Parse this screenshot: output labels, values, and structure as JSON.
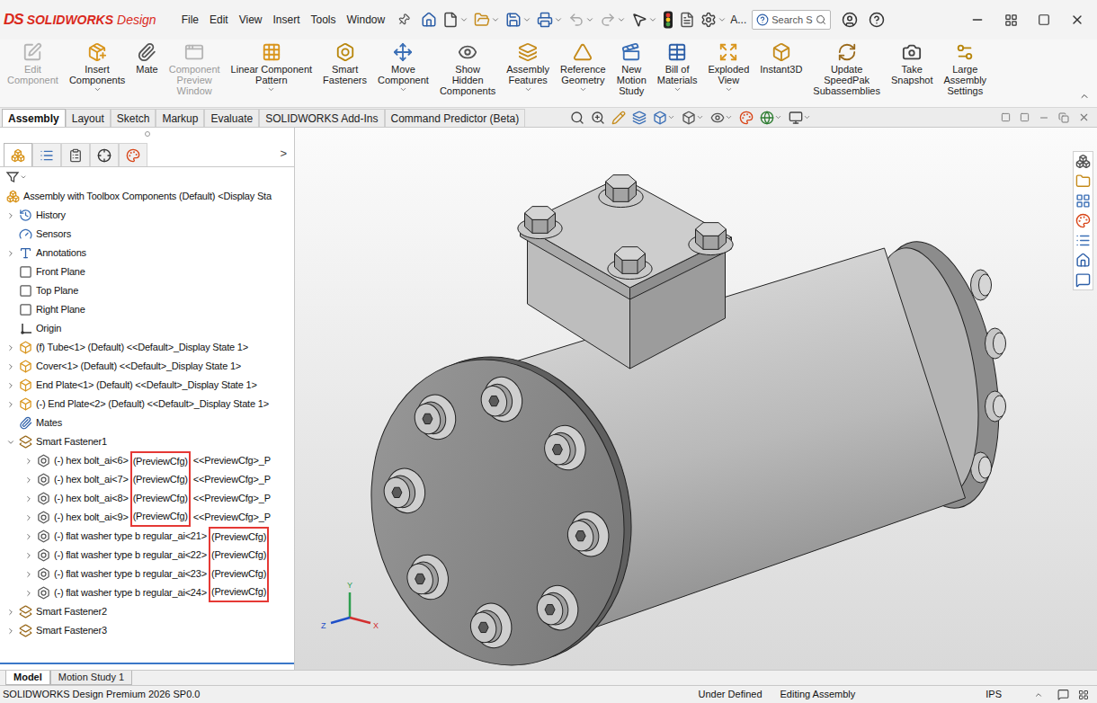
{
  "window": {
    "logo_mark": "DS",
    "brand": "SOLIDWORKS",
    "edition": "Design",
    "user": "A...",
    "search_placeholder": "Search S"
  },
  "menus": [
    "File",
    "Edit",
    "View",
    "Insert",
    "Tools",
    "Window"
  ],
  "quick_access": [
    {
      "dropdown": false,
      "disabled": false
    },
    {
      "dropdown": true,
      "disabled": false
    },
    {
      "dropdown": true,
      "disabled": false
    },
    {
      "dropdown": true,
      "disabled": false
    },
    {
      "dropdown": true,
      "disabled": false
    },
    {
      "dropdown": true,
      "disabled": true
    },
    {
      "dropdown": true,
      "disabled": true
    },
    {
      "dropdown": true,
      "disabled": false
    },
    {
      "dropdown": false,
      "disabled": false
    },
    {
      "dropdown": false,
      "disabled": false
    },
    {
      "dropdown": true,
      "disabled": false
    }
  ],
  "command_manager": [
    {
      "lines": [
        "Edit",
        "Component"
      ],
      "dropdown": false,
      "disabled": true
    },
    {
      "lines": [
        "Insert",
        "Components"
      ],
      "dropdown": true,
      "disabled": false
    },
    {
      "lines": [
        "Mate"
      ],
      "dropdown": false,
      "disabled": false
    },
    {
      "lines": [
        "Component",
        "Preview",
        "Window"
      ],
      "dropdown": false,
      "disabled": true
    },
    {
      "lines": [
        "Linear Component",
        "Pattern"
      ],
      "dropdown": true,
      "disabled": false
    },
    {
      "lines": [
        "Smart",
        "Fasteners"
      ],
      "dropdown": false,
      "disabled": false
    },
    {
      "lines": [
        "Move",
        "Component"
      ],
      "dropdown": true,
      "disabled": false
    },
    {
      "lines": [
        "Show",
        "Hidden",
        "Components"
      ],
      "dropdown": false,
      "disabled": false
    },
    {
      "lines": [
        "Assembly",
        "Features"
      ],
      "dropdown": true,
      "disabled": false
    },
    {
      "lines": [
        "Reference",
        "Geometry"
      ],
      "dropdown": true,
      "disabled": false
    },
    {
      "lines": [
        "New",
        "Motion",
        "Study"
      ],
      "dropdown": false,
      "disabled": false
    },
    {
      "lines": [
        "Bill of",
        "Materials"
      ],
      "dropdown": true,
      "disabled": false
    },
    {
      "lines": [
        "Exploded",
        "View"
      ],
      "dropdown": true,
      "disabled": false
    },
    {
      "lines": [
        "Instant3D"
      ],
      "dropdown": false,
      "disabled": false
    },
    {
      "lines": [
        "Update",
        "SpeedPak",
        "Subassemblies"
      ],
      "dropdown": false,
      "disabled": false
    },
    {
      "lines": [
        "Take",
        "Snapshot"
      ],
      "dropdown": false,
      "disabled": false
    },
    {
      "lines": [
        "Large",
        "Assembly",
        "Settings"
      ],
      "dropdown": false,
      "disabled": false
    }
  ],
  "ribbon_tabs": [
    {
      "label": "Assembly",
      "selected": true
    },
    {
      "label": "Layout",
      "selected": false
    },
    {
      "label": "Sketch",
      "selected": false
    },
    {
      "label": "Markup",
      "selected": false
    },
    {
      "label": "Evaluate",
      "selected": false
    },
    {
      "label": "SOLIDWORKS Add-Ins",
      "selected": false
    },
    {
      "label": "Command Predictor (Beta)",
      "selected": false
    }
  ],
  "heads_up_toolbar": [
    {
      "dropdown": false
    },
    {
      "dropdown": false
    },
    {
      "dropdown": false
    },
    {
      "dropdown": false
    },
    {
      "dropdown": true
    },
    {
      "dropdown": true
    },
    {
      "dropdown": true
    },
    {
      "dropdown": false
    },
    {
      "dropdown": true
    },
    {
      "dropdown": true
    }
  ],
  "panel_tabs": [
    {
      "selected": true
    },
    {
      "selected": false
    },
    {
      "selected": false
    },
    {
      "selected": false
    },
    {
      "selected": false
    }
  ],
  "panel_overflow": ">",
  "tree": [
    {
      "text": "Assembly with Toolbox Components (Default) <Display Sta",
      "kind": "assembly",
      "depth": 0,
      "expandable": false,
      "expanded": true
    },
    {
      "text": "History",
      "kind": "history",
      "depth": 1,
      "expandable": true,
      "expanded": false
    },
    {
      "text": "Sensors",
      "kind": "sensor",
      "depth": 1,
      "expandable": false,
      "expanded": false
    },
    {
      "text": "Annotations",
      "kind": "annotation",
      "depth": 1,
      "expandable": true,
      "expanded": false
    },
    {
      "text": "Front Plane",
      "kind": "plane",
      "depth": 1,
      "expandable": false,
      "expanded": false
    },
    {
      "text": "Top Plane",
      "kind": "plane",
      "depth": 1,
      "expandable": false,
      "expanded": false
    },
    {
      "text": "Right Plane",
      "kind": "plane",
      "depth": 1,
      "expandable": false,
      "expanded": false
    },
    {
      "text": "Origin",
      "kind": "origin",
      "depth": 1,
      "expandable": false,
      "expanded": false
    },
    {
      "text": "(f) Tube<1> (Default) <<Default>_Display State 1>",
      "kind": "part",
      "depth": 1,
      "expandable": true,
      "expanded": false
    },
    {
      "text": "Cover<1> (Default) <<Default>_Display State 1>",
      "kind": "part",
      "depth": 1,
      "expandable": true,
      "expanded": false
    },
    {
      "text": "End Plate<1> (Default) <<Default>_Display State 1>",
      "kind": "part",
      "depth": 1,
      "expandable": true,
      "expanded": false
    },
    {
      "text": "(-) End Plate<2> (Default) <<Default>_Display State 1>",
      "kind": "part",
      "depth": 1,
      "expandable": true,
      "expanded": false
    },
    {
      "text": "Mates",
      "kind": "mates",
      "depth": 1,
      "expandable": false,
      "expanded": false
    },
    {
      "text": "Smart Fastener1",
      "kind": "smart-fastener",
      "depth": 1,
      "expandable": true,
      "expanded": true
    },
    {
      "text": "(-) hex bolt_ai<6>",
      "config": "(PreviewCfg)",
      "suffix": "<<PreviewCfg>_P",
      "highlighted": true,
      "kind": "fastener",
      "depth": 2,
      "expandable": true,
      "expanded": false
    },
    {
      "text": "(-) hex bolt_ai<7>",
      "config": "(PreviewCfg)",
      "suffix": "<<PreviewCfg>_P",
      "highlighted": true,
      "kind": "fastener",
      "depth": 2,
      "expandable": true,
      "expanded": false
    },
    {
      "text": "(-) hex bolt_ai<8>",
      "config": "(PreviewCfg)",
      "suffix": "<<PreviewCfg>_P",
      "highlighted": true,
      "kind": "fastener",
      "depth": 2,
      "expandable": true,
      "expanded": false
    },
    {
      "text": "(-) hex bolt_ai<9>",
      "config": "(PreviewCfg)",
      "suffix": "<<PreviewCfg>_P",
      "highlighted": true,
      "kind": "fastener",
      "depth": 2,
      "expandable": true,
      "expanded": false
    },
    {
      "text": "(-) flat washer type b regular_ai<21>",
      "config": "(PreviewCfg)",
      "highlighted": true,
      "kind": "fastener",
      "depth": 2,
      "expandable": true,
      "expanded": false
    },
    {
      "text": "(-) flat washer type b regular_ai<22>",
      "config": "(PreviewCfg)",
      "highlighted": true,
      "kind": "fastener",
      "depth": 2,
      "expandable": true,
      "expanded": false
    },
    {
      "text": "(-) flat washer type b regular_ai<23>",
      "config": "(PreviewCfg)",
      "highlighted": true,
      "kind": "fastener",
      "depth": 2,
      "expandable": true,
      "expanded": false
    },
    {
      "text": "(-) flat washer type b regular_ai<24>",
      "config": "(PreviewCfg)",
      "highlighted": true,
      "kind": "fastener",
      "depth": 2,
      "expandable": true,
      "expanded": false
    },
    {
      "text": "Smart Fastener2",
      "kind": "smart-fastener",
      "depth": 1,
      "expandable": true,
      "expanded": false
    },
    {
      "text": "Smart Fastener3",
      "kind": "smart-fastener",
      "depth": 1,
      "expandable": true,
      "expanded": false
    }
  ],
  "viewport": {
    "triad": {
      "y": "Y",
      "x": "X",
      "z": "Z"
    }
  },
  "bottom_tabs": [
    {
      "label": "Model",
      "selected": true
    },
    {
      "label": "Motion Study 1",
      "selected": false
    }
  ],
  "status_bar": {
    "product": "SOLIDWORKS Design Premium 2026 SP0.0",
    "state": "Under Defined",
    "mode": "Editing Assembly",
    "units": "IPS"
  }
}
